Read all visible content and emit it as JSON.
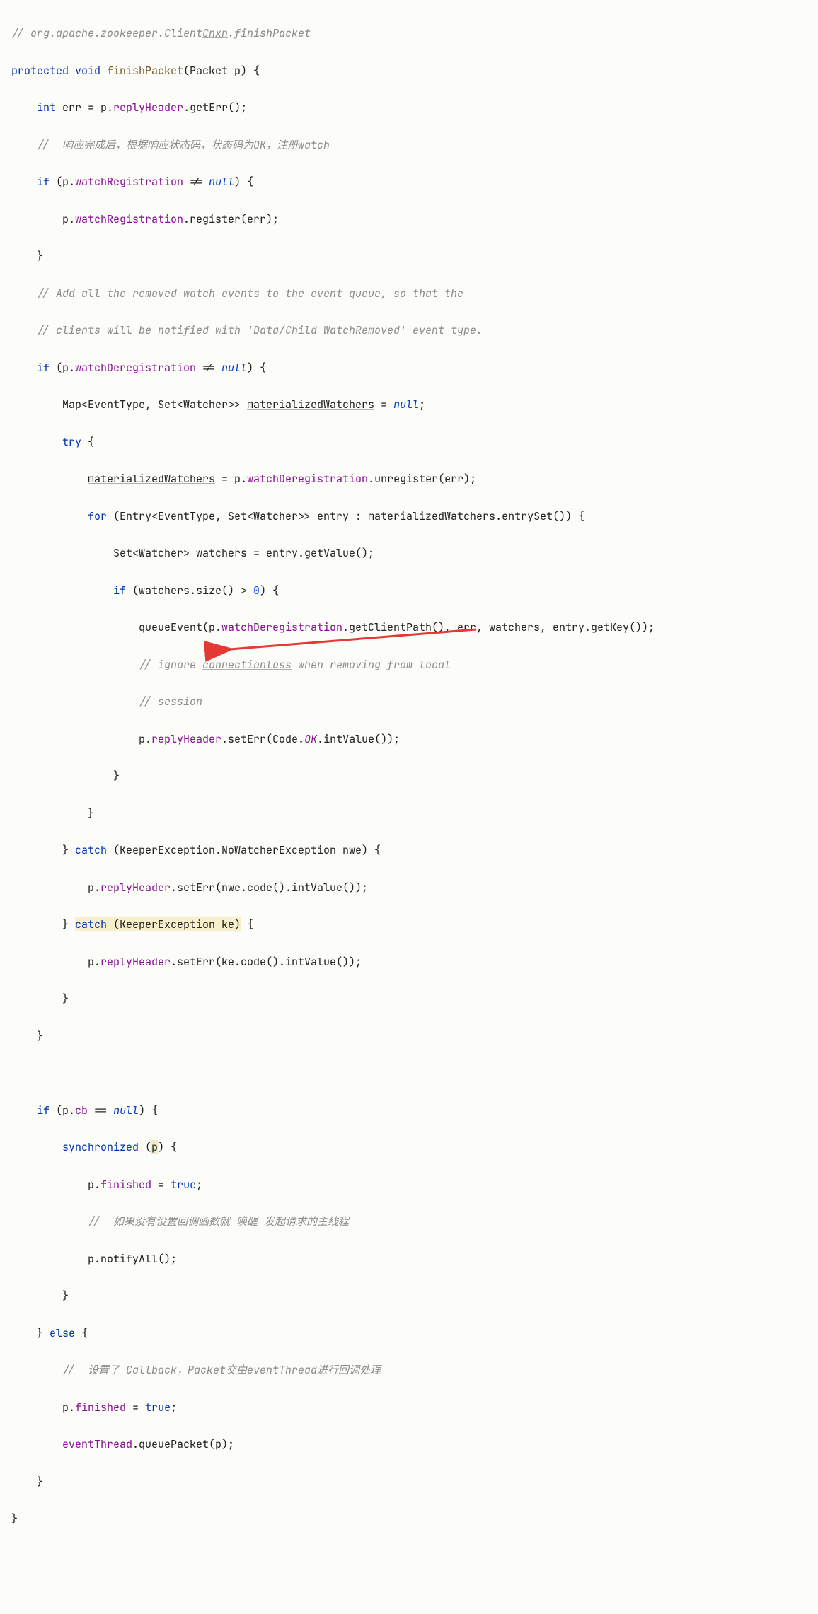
{
  "lines": {
    "l0": "// org.apache.zookeeper.Client",
    "l0b": ".finishPacket",
    "l0u": "Cnxn",
    "l1a": "protected void ",
    "l1b": "finishPacket",
    "l1c": "(Packet p) {",
    "l2": "int err = p.",
    "l2b": "replyHeader",
    "l2c": ".getErr();",
    "l3": "//  响应完成后，根据响应状态码，状态码为OK，注册watch",
    "l4a": "if",
    "l4b": " (p.",
    "l4c": "watchRegistration",
    "l4d": " != ",
    "l4e": "null",
    "l4f": ") {",
    "l5a": "p.",
    "l5b": "watchRegistration",
    "l5c": ".register(err);",
    "l6": "}",
    "l7": "// Add all the removed watch events to the event queue, so that the",
    "l8": "// clients will be notified with 'Data/Child WatchRemoved' event type.",
    "l9a": "if",
    "l9b": " (p.",
    "l9c": "watchDeregistration",
    "l9d": " != ",
    "l9e": "null",
    "l9f": ") {",
    "l10a": "Map<EventType, Set<Watcher>> ",
    "l10b": "materializedWatchers",
    "l10c": " = ",
    "l10d": "null",
    "l10e": ";",
    "l11a": "try",
    "l11b": " {",
    "l12a": "materializedWatchers",
    "l12b": " = p.",
    "l12c": "watchDeregistration",
    "l12d": ".unregister(err);",
    "l13a": "for",
    "l13b": " (Entry<EventType, Set<Watcher>> entry : ",
    "l13c": "materializedWatchers",
    "l13d": ".entrySet()) {",
    "l14": "Set<Watcher> watchers = entry.getValue();",
    "l15a": "if",
    "l15b": " (watchers.size() > ",
    "l15c": "0",
    "l15d": ") {",
    "l16a": "queueEvent(p.",
    "l16b": "watchDeregistration",
    "l16c": ".getClientPath(), err, watchers, entry.getKey());",
    "l17a": "// ignore ",
    "l17b": "connectionloss",
    "l17c": " when removing from local",
    "l18": "// session",
    "l19a": "p.",
    "l19b": "replyHeader",
    "l19c": ".setErr(Code.",
    "l19d": "OK",
    "l19e": ".intValue());",
    "l20": "}",
    "l21": "}",
    "l22a": "} ",
    "l22b": "catch",
    "l22c": " (KeeperException.NoWatcherException nwe) {",
    "l23a": "p.",
    "l23b": "replyHeader",
    "l23c": ".setErr(nwe.code().intValue());",
    "l24a": "} ",
    "l24b": "catch",
    "l24c": " (KeeperException ke)",
    "l24d": " {",
    "l25a": "p.",
    "l25b": "replyHeader",
    "l25c": ".setErr(ke.code().intValue());",
    "l26": "}",
    "l27": "}",
    "l28a": "if",
    "l28b": " (p.",
    "l28c": "cb",
    "l28d": " == ",
    "l28e": "null",
    "l28f": ") {",
    "l29a": "synchronized",
    "l29b": " (",
    "l29c": "p",
    "l29d": ") {",
    "l30a": "p.",
    "l30b": "finished",
    "l30c": " = ",
    "l30d": "true",
    "l30e": ";",
    "l31": "//  如果没有设置回调函数就 唤醒 发起请求的主线程",
    "l32": "p.notifyAll();",
    "l33": "}",
    "l34a": "} ",
    "l34b": "else",
    "l34c": " {",
    "l35": "//  设置了 Callback，Packet交由eventThread进行回调处理",
    "l36a": "p.",
    "l36b": "finished",
    "l36c": " = ",
    "l36d": "true",
    "l36e": ";",
    "l37a": "eventThread",
    "l37b": ".queuePacket(p);",
    "l38": "}",
    "l39": "}"
  },
  "indent": {
    "i1": "    ",
    "i2": "        ",
    "i3": "            ",
    "i4": "                ",
    "i5": "                    ",
    "i6": "                        "
  }
}
